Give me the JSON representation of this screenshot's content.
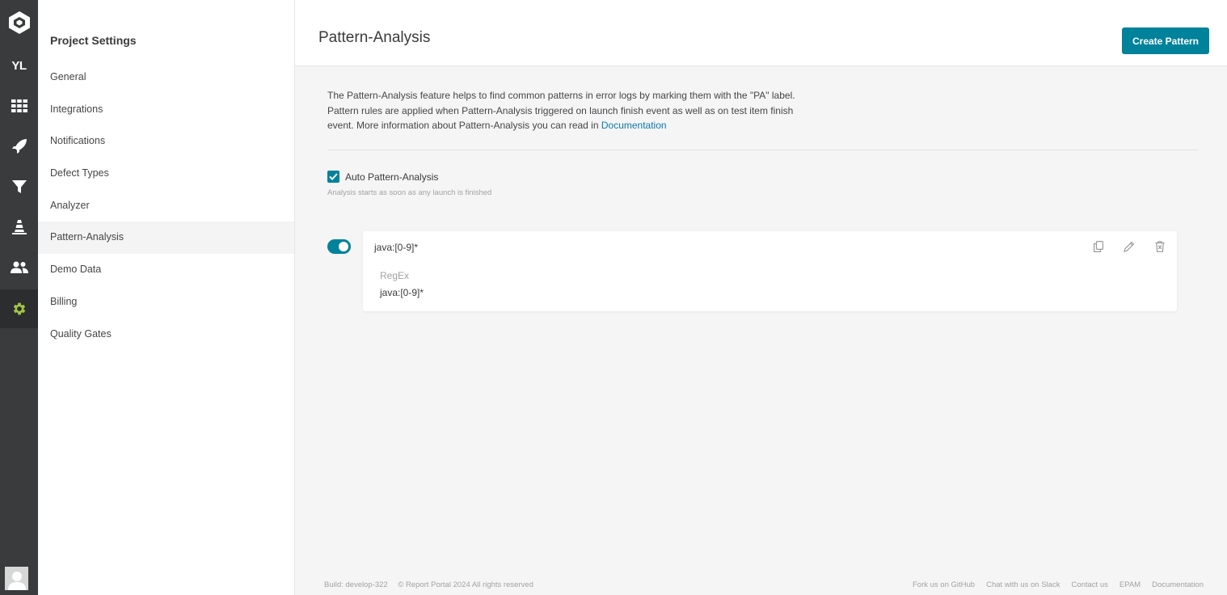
{
  "rail": {
    "project_initials": "YL",
    "items": [
      {
        "icon": "dashboard-grid-icon"
      },
      {
        "icon": "rocket-launches-icon"
      },
      {
        "icon": "filter-icon"
      },
      {
        "icon": "debug-cone-icon"
      },
      {
        "icon": "members-icon"
      },
      {
        "icon": "settings-gear-icon",
        "active": true
      }
    ]
  },
  "sidebar": {
    "title": "Project Settings",
    "items": [
      {
        "label": "General"
      },
      {
        "label": "Integrations"
      },
      {
        "label": "Notifications"
      },
      {
        "label": "Defect Types"
      },
      {
        "label": "Analyzer"
      },
      {
        "label": "Pattern-Analysis",
        "active": true
      },
      {
        "label": "Demo Data"
      },
      {
        "label": "Billing"
      },
      {
        "label": "Quality Gates"
      }
    ]
  },
  "header": {
    "title": "Pattern-Analysis",
    "create_button": "Create Pattern"
  },
  "description": {
    "text": "The Pattern-Analysis feature helps to find common patterns in error logs by marking them with the \"PA\" label. Pattern rules are applied when Pattern-Analysis triggered on launch finish event as well as on test item finish event. More information about Pattern-Analysis you can read in ",
    "link": "Documentation"
  },
  "auto_analysis": {
    "label": "Auto Pattern-Analysis",
    "checked": true,
    "hint": "Analysis starts as soon as any launch is finished"
  },
  "patterns": [
    {
      "enabled": true,
      "name": "java:[0-9]*",
      "type": "RegEx",
      "value": "java:[0-9]*"
    }
  ],
  "footer": {
    "build": "Build: develop-322",
    "copyright": "© Report Portal 2024 All rights reserved",
    "links": [
      "Fork us on GitHub",
      "Chat with us on Slack",
      "Contact us",
      "EPAM",
      "Documentation"
    ]
  },
  "colors": {
    "accent": "#00829b",
    "rail_bg": "#3a3b3d",
    "active_gear": "#a3c644",
    "link": "#0a7ab0"
  }
}
